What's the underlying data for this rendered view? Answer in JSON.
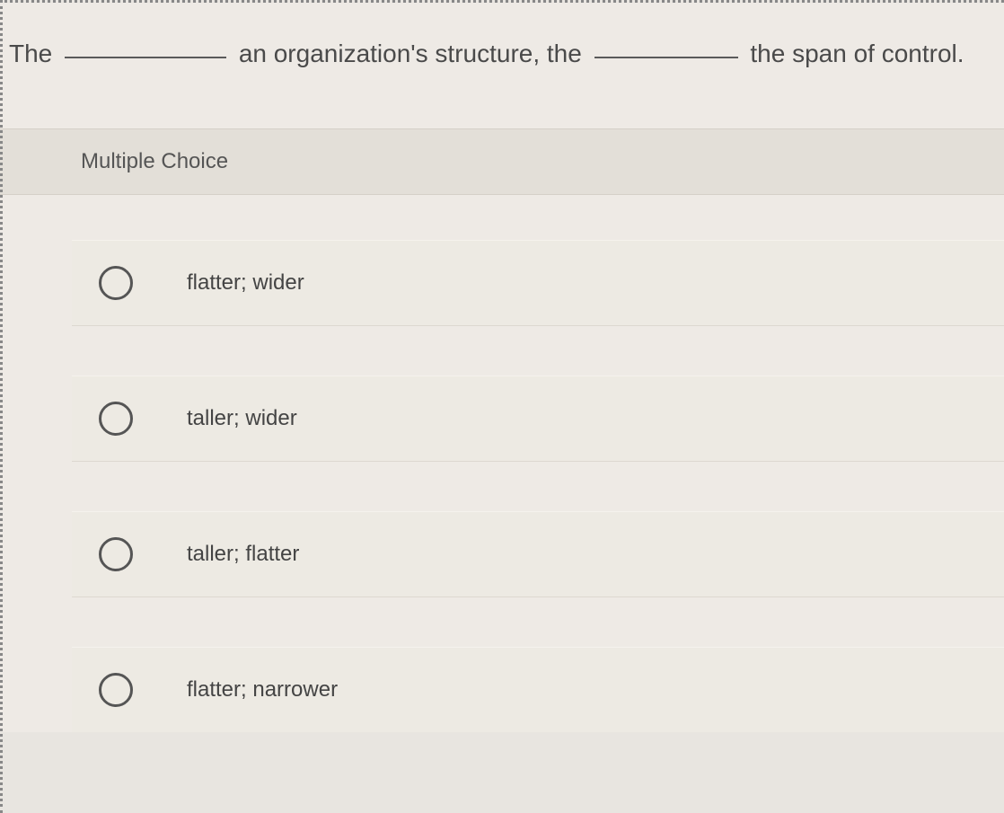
{
  "question": {
    "part1": "The",
    "part2": "an organization's structure, the",
    "part3": "the span of control."
  },
  "section_header": "Multiple Choice",
  "options": [
    {
      "label": "flatter; wider"
    },
    {
      "label": "taller; wider"
    },
    {
      "label": "taller; flatter"
    },
    {
      "label": "flatter; narrower"
    }
  ]
}
